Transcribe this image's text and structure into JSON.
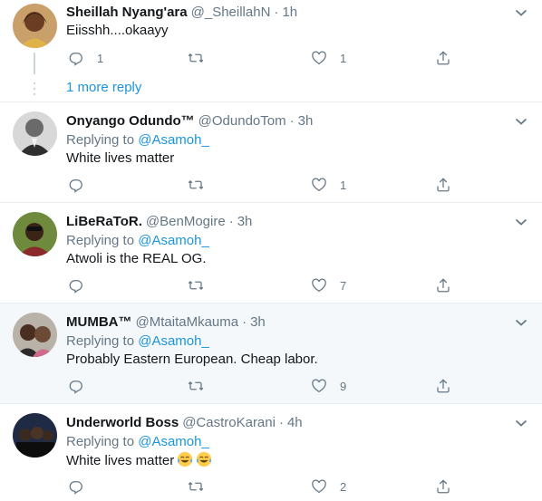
{
  "tweets": [
    {
      "name": "Sheillah Nyang'ara",
      "handle": "@_SheillahN",
      "time": "1h",
      "replying_label": "",
      "mention": "",
      "text": "Eiisshh....okaayy",
      "reply_count": "1",
      "retweet_count": "",
      "like_count": "1",
      "more_replies": "1 more reply"
    },
    {
      "name": "Onyango Odundo™",
      "handle": "@OdundoTom",
      "time": "3h",
      "replying_label": "Replying to",
      "mention": "@Asamoh_",
      "text": "White lives matter",
      "reply_count": "",
      "retweet_count": "",
      "like_count": "1"
    },
    {
      "name": "LiBeRaToR.",
      "handle": "@BenMogire",
      "time": "3h",
      "replying_label": "Replying to",
      "mention": "@Asamoh_",
      "text": "Atwoli is the REAL OG.",
      "reply_count": "",
      "retweet_count": "",
      "like_count": "7"
    },
    {
      "name": "MUMBA™",
      "handle": "@MtaitaMkauma",
      "time": "3h",
      "replying_label": "Replying to",
      "mention": "@Asamoh_",
      "text": "Probably Eastern European. Cheap labor.",
      "reply_count": "",
      "retweet_count": "",
      "like_count": "9"
    },
    {
      "name": "Underworld Boss",
      "handle": "@CastroKarani",
      "time": "4h",
      "replying_label": "Replying to",
      "mention": "@Asamoh_",
      "text": "White lives matter",
      "reply_count": "",
      "retweet_count": "",
      "like_count": "2",
      "emoji": [
        "face-with-tears-of-joy-icon",
        "face-with-tears-of-joy-icon"
      ]
    }
  ],
  "dot": "·",
  "colors": {
    "link": "#1b95e0",
    "secondary_text": "#657786",
    "highlight_bg": "#f5f8fa",
    "divider": "#e6ecf0"
  }
}
